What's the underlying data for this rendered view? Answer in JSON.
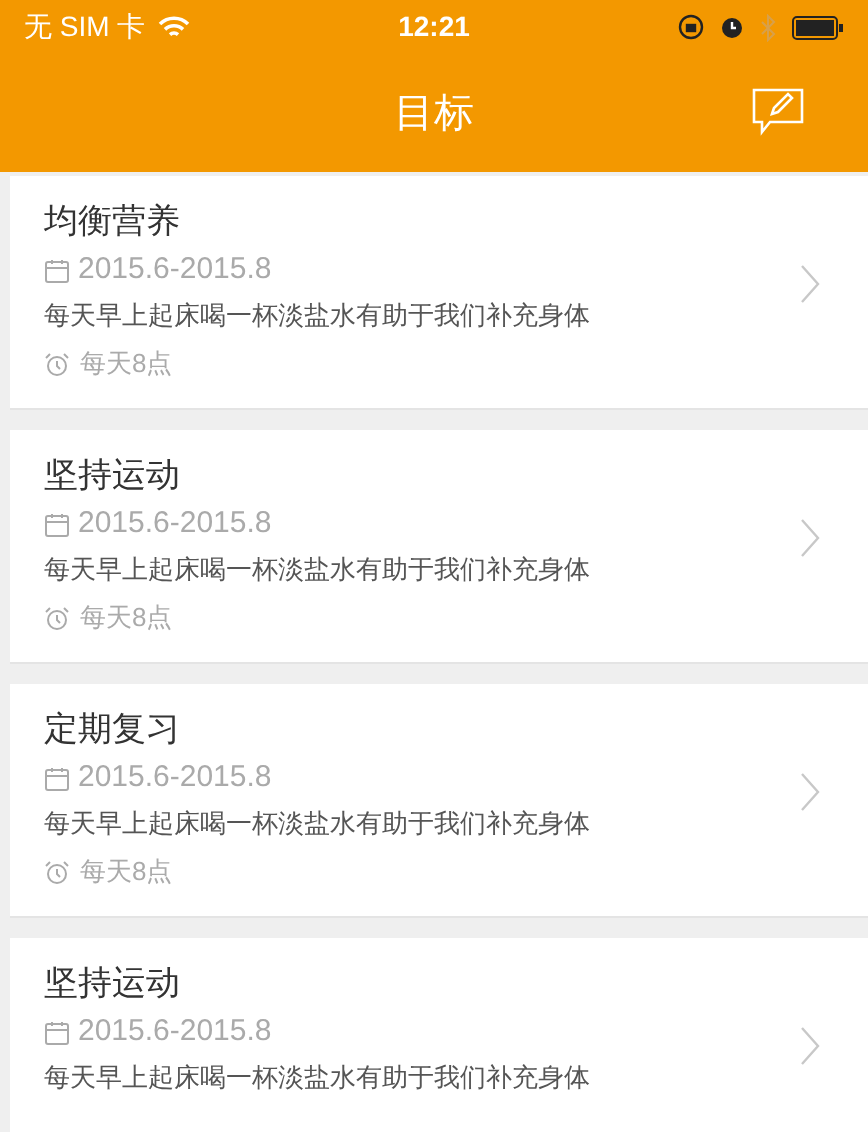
{
  "status_bar": {
    "carrier": "无 SIM 卡",
    "time": "12:21"
  },
  "nav": {
    "title": "目标"
  },
  "goals": [
    {
      "title": "均衡营养",
      "period": "2015.6-2015.8",
      "description": "每天早上起床喝一杯淡盐水有助于我们补充身体",
      "reminder": "每天8点"
    },
    {
      "title": "坚持运动",
      "period": "2015.6-2015.8",
      "description": "每天早上起床喝一杯淡盐水有助于我们补充身体",
      "reminder": "每天8点"
    },
    {
      "title": "定期复习",
      "period": "2015.6-2015.8",
      "description": "每天早上起床喝一杯淡盐水有助于我们补充身体",
      "reminder": "每天8点"
    },
    {
      "title": "坚持运动",
      "period": "2015.6-2015.8",
      "description": "每天早上起床喝一杯淡盐水有助于我们补充身体"
    }
  ]
}
